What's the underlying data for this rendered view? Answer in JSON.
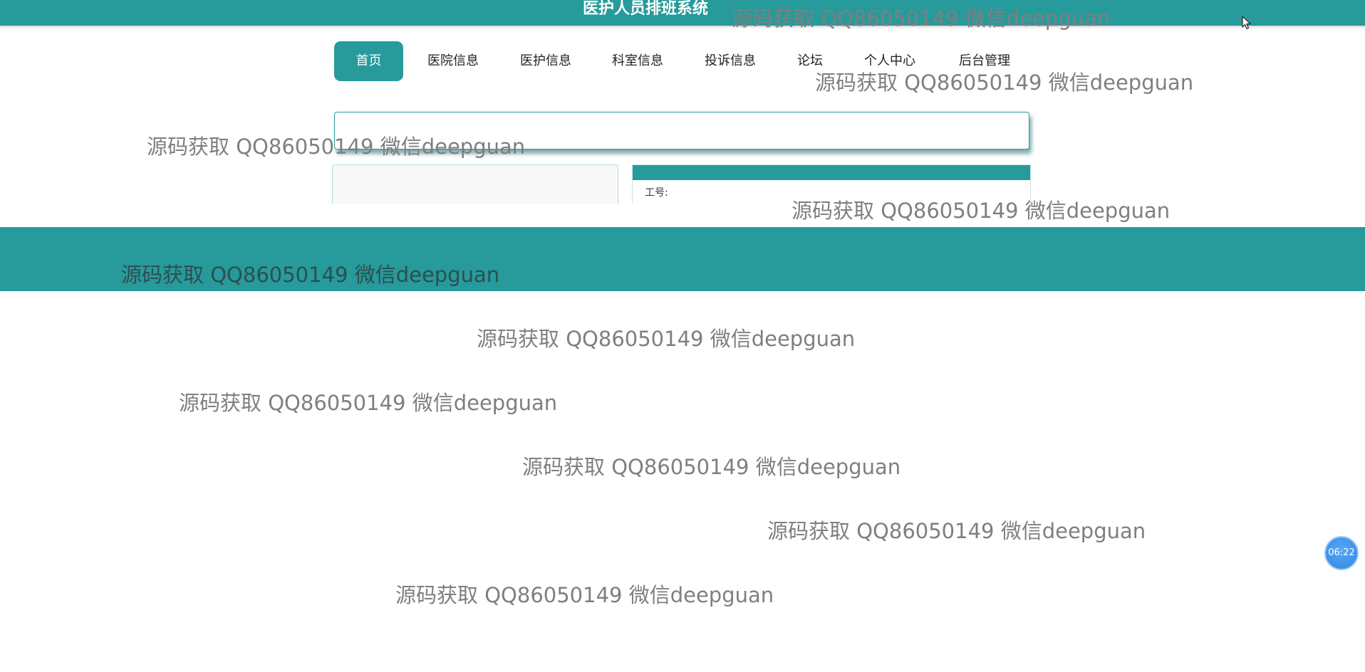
{
  "header": {
    "title": "医护人员排班系统",
    "background_color": "#279a9b"
  },
  "nav": {
    "items": [
      {
        "label": "首页",
        "active": true
      },
      {
        "label": "医院信息"
      },
      {
        "label": "医护信息"
      },
      {
        "label": "科室信息"
      },
      {
        "label": "投诉信息"
      },
      {
        "label": "论坛"
      },
      {
        "label": "个人中心"
      },
      {
        "label": "后台管理"
      }
    ]
  },
  "search": {
    "value": ""
  },
  "detail_card": {
    "label": "工号:"
  },
  "watermark_text": "源码获取 QQ86050149 微信deepguan",
  "timer": {
    "label": "06:22"
  },
  "icons": {
    "cursor": "mouse-pointer-icon"
  }
}
